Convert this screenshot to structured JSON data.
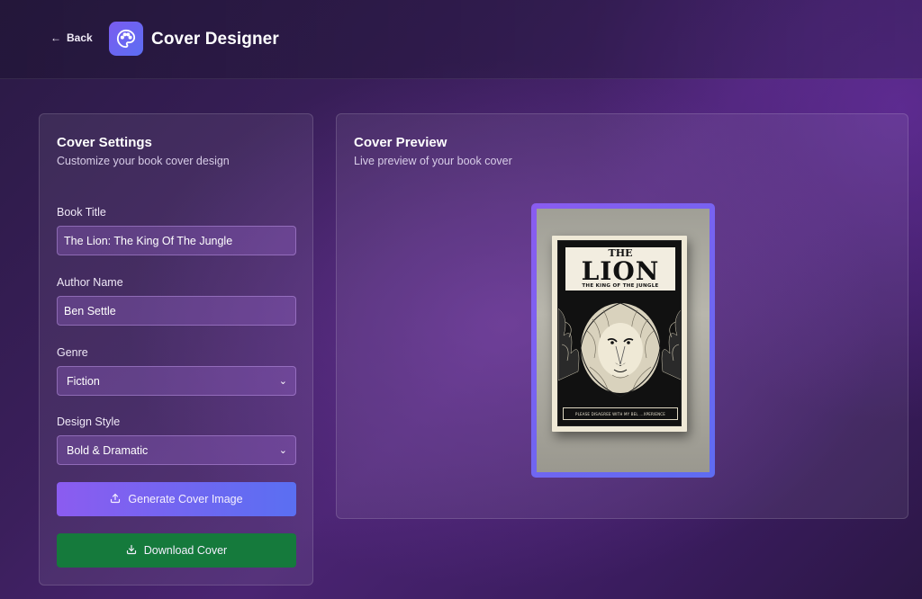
{
  "header": {
    "back_label": "Back",
    "app_title": "Cover Designer",
    "logo_icon": "palette-icon"
  },
  "settings": {
    "title": "Cover Settings",
    "subtitle": "Customize your book cover design",
    "fields": {
      "book_title": {
        "label": "Book Title",
        "value": "The Lion: The King Of The Jungle"
      },
      "author_name": {
        "label": "Author Name",
        "value": "Ben Settle"
      },
      "genre": {
        "label": "Genre",
        "value": "Fiction"
      },
      "design_style": {
        "label": "Design Style",
        "value": "Bold & Dramatic"
      }
    },
    "generate_label": "Generate Cover Image",
    "download_label": "Download Cover"
  },
  "preview": {
    "title": "Cover Preview",
    "subtitle": "Live preview of your book cover",
    "book": {
      "title_top": "THE",
      "title_main": "LION",
      "title_sub": "THE KING OF THE JUNGLE",
      "footer_text": "PLEASE DISAGREE WITH MY BEL ...XPERIENCE"
    }
  },
  "colors": {
    "accent_gradient_start": "#8b5cf0",
    "accent_gradient_end": "#5a6ff2",
    "download_green": "#157a3c",
    "background": "#3b1f5c"
  }
}
